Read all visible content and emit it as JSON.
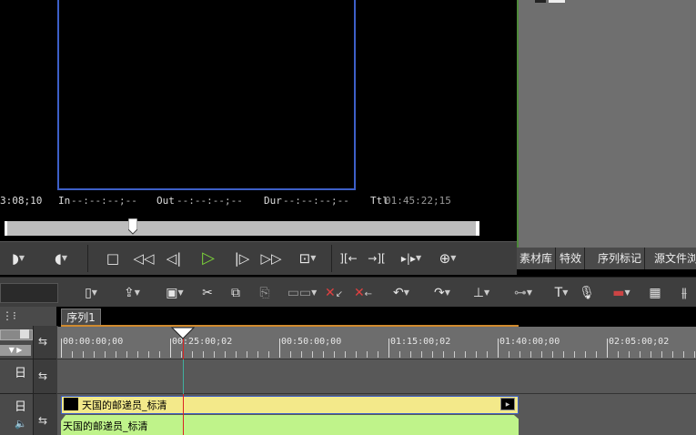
{
  "player": {
    "tc_start": "3:08;10",
    "in_label": "In",
    "in_value": "--:--:--;--",
    "out_label": "Out",
    "out_value": "--:--:--;--",
    "dur_label": "Dur",
    "dur_value": "--:--:--;--",
    "ttl_label": "Ttl",
    "ttl_value": "01:45:22;15",
    "scrub_position": 0.27
  },
  "player_controls": {
    "mark_in": "◗",
    "mark_out": "◖",
    "stop": "□",
    "rewind": "◁◁",
    "step_back": "◁|",
    "play": "▷",
    "step_forward": "|▷",
    "fast_forward": "▷▷",
    "loop": "⊡",
    "goto_in": "][←",
    "goto_out": "→][",
    "trim": "▸|▸",
    "split": "⊕"
  },
  "library": {
    "tabs": [
      "素材库",
      "特效",
      "序列标记",
      "源文件浏"
    ]
  },
  "toolbar": {
    "icons": [
      "new-icon",
      "import-icon",
      "save-icon",
      "cut-icon",
      "copy-icon",
      "paste-icon",
      "group-icon",
      "delete-icon",
      "ripple-delete-icon",
      "undo-icon",
      "redo-icon",
      "insert-icon",
      "link-icon",
      "title-icon",
      "voice-icon",
      "record-icon",
      "layout-icon",
      "mixer-icon"
    ]
  },
  "timeline": {
    "sequence_tab": "序列1",
    "ruler_ticks": [
      "00:00:00;00",
      "00:25:00;02",
      "00:50:00;00",
      "01:15:00;02",
      "01:40:00;00",
      "02:05:00;02"
    ],
    "playhead_position": 0.26,
    "track_label_1": "日",
    "track_label_2": "日",
    "video_clip_name": "天国的邮递员_标清",
    "audio_clip_name": "天国的邮递员_标清"
  },
  "colors": {
    "video_clip": "#f3e98a",
    "audio_clip": "#bff38a",
    "accent_green": "#4e8a3a",
    "frame_blue": "#3d5fc8"
  }
}
